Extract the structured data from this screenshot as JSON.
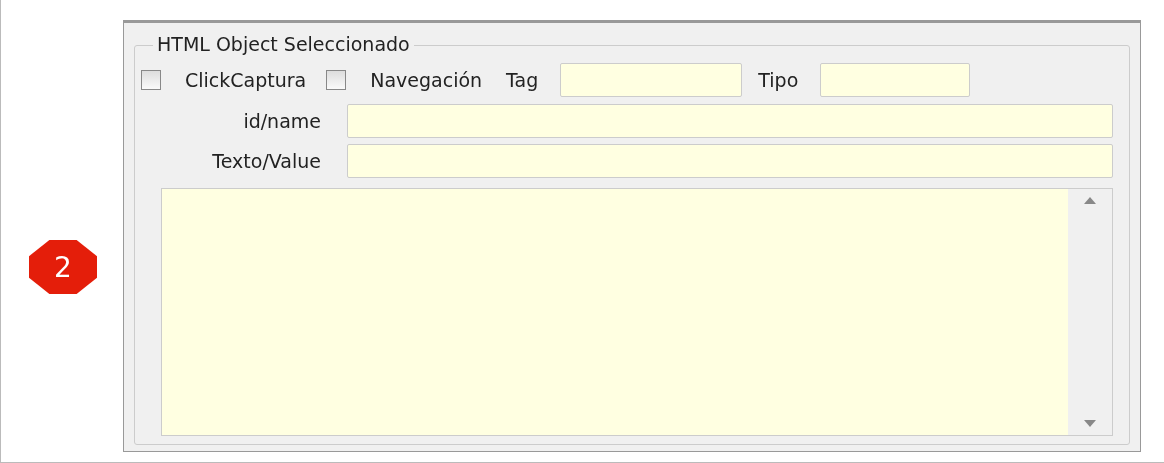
{
  "badge": {
    "text": "2"
  },
  "group": {
    "title": "HTML Object Seleccionado"
  },
  "row1": [
    {
      "kind": "checkbox",
      "label": "ClickCaptura",
      "checked": false
    },
    {
      "kind": "checkbox",
      "label": "Navegación",
      "checked": false
    },
    {
      "kind": "field",
      "label": "Tag"
    },
    {
      "kind": "field",
      "label": "Tipo"
    }
  ],
  "fields": [
    {
      "label": "id/name"
    },
    {
      "label": "Texto/Value"
    }
  ]
}
